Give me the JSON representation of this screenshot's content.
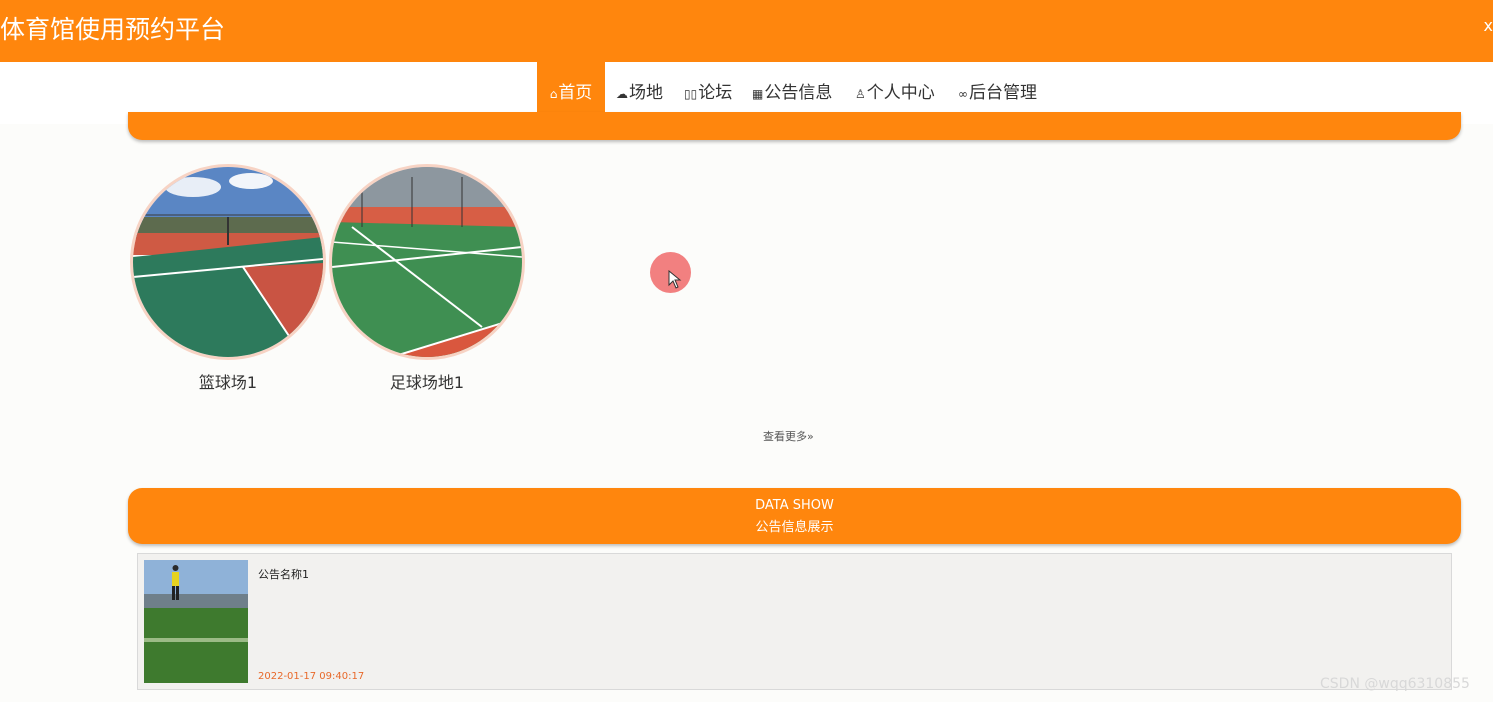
{
  "header": {
    "title": "体育馆使用预约平台",
    "close_label": "x"
  },
  "nav": {
    "items": [
      {
        "label": "首页",
        "icon": "home-icon",
        "glyph": "⌂",
        "active": true
      },
      {
        "label": "场地",
        "icon": "cloud-icon",
        "glyph": "☁",
        "active": false
      },
      {
        "label": "论坛",
        "icon": "forum-icon",
        "glyph": "▯▯",
        "active": false
      },
      {
        "label": "公告信息",
        "icon": "calendar-icon",
        "glyph": "▦",
        "active": false
      },
      {
        "label": "个人中心",
        "icon": "user-icon",
        "glyph": "♙",
        "active": false
      },
      {
        "label": "后台管理",
        "icon": "link-icon",
        "glyph": "∞",
        "active": false
      }
    ]
  },
  "venues": {
    "items": [
      {
        "name": "篮球场1"
      },
      {
        "name": "足球场地1"
      }
    ],
    "more_label": "查看更多»"
  },
  "notices_section": {
    "title_en": "DATA SHOW",
    "title_cn": "公告信息展示",
    "items": [
      {
        "title": "公告名称1",
        "time": "2022-01-17 09:40:17"
      }
    ]
  },
  "watermark": "CSDN @wqq6310855",
  "colors": {
    "accent": "#ff860d",
    "time_text": "#e8692a"
  }
}
